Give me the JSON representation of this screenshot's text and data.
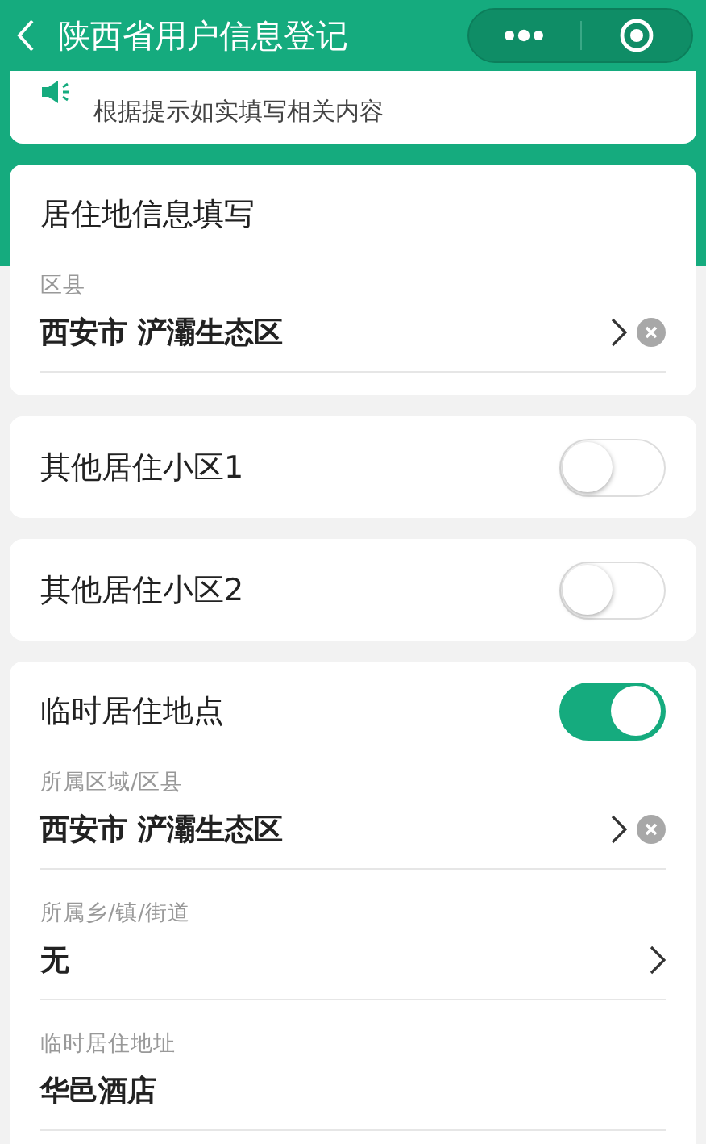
{
  "header": {
    "title": "陕西省用户信息登记"
  },
  "notice": {
    "text": "根据提示如实填写相关内容"
  },
  "sections": [
    {
      "kind": "form",
      "title": "居住地信息填写",
      "fields": [
        {
          "label": "区县",
          "value": "西安市 浐灞生态区",
          "has_arrow": true,
          "clearable": true
        }
      ]
    },
    {
      "kind": "toggle",
      "title": "其他居住小区1",
      "on": false
    },
    {
      "kind": "toggle",
      "title": "其他居住小区2",
      "on": false
    },
    {
      "kind": "form",
      "title": "临时居住地点",
      "on": true,
      "fields": [
        {
          "label": "所属区域/区县",
          "value": "西安市 浐灞生态区",
          "has_arrow": true,
          "clearable": true
        },
        {
          "label": "所属乡/镇/街道",
          "value": "无",
          "has_arrow": true,
          "clearable": false
        },
        {
          "label": "临时居住地址",
          "value": "华邑酒店",
          "has_arrow": false,
          "clearable": false
        }
      ]
    }
  ]
}
